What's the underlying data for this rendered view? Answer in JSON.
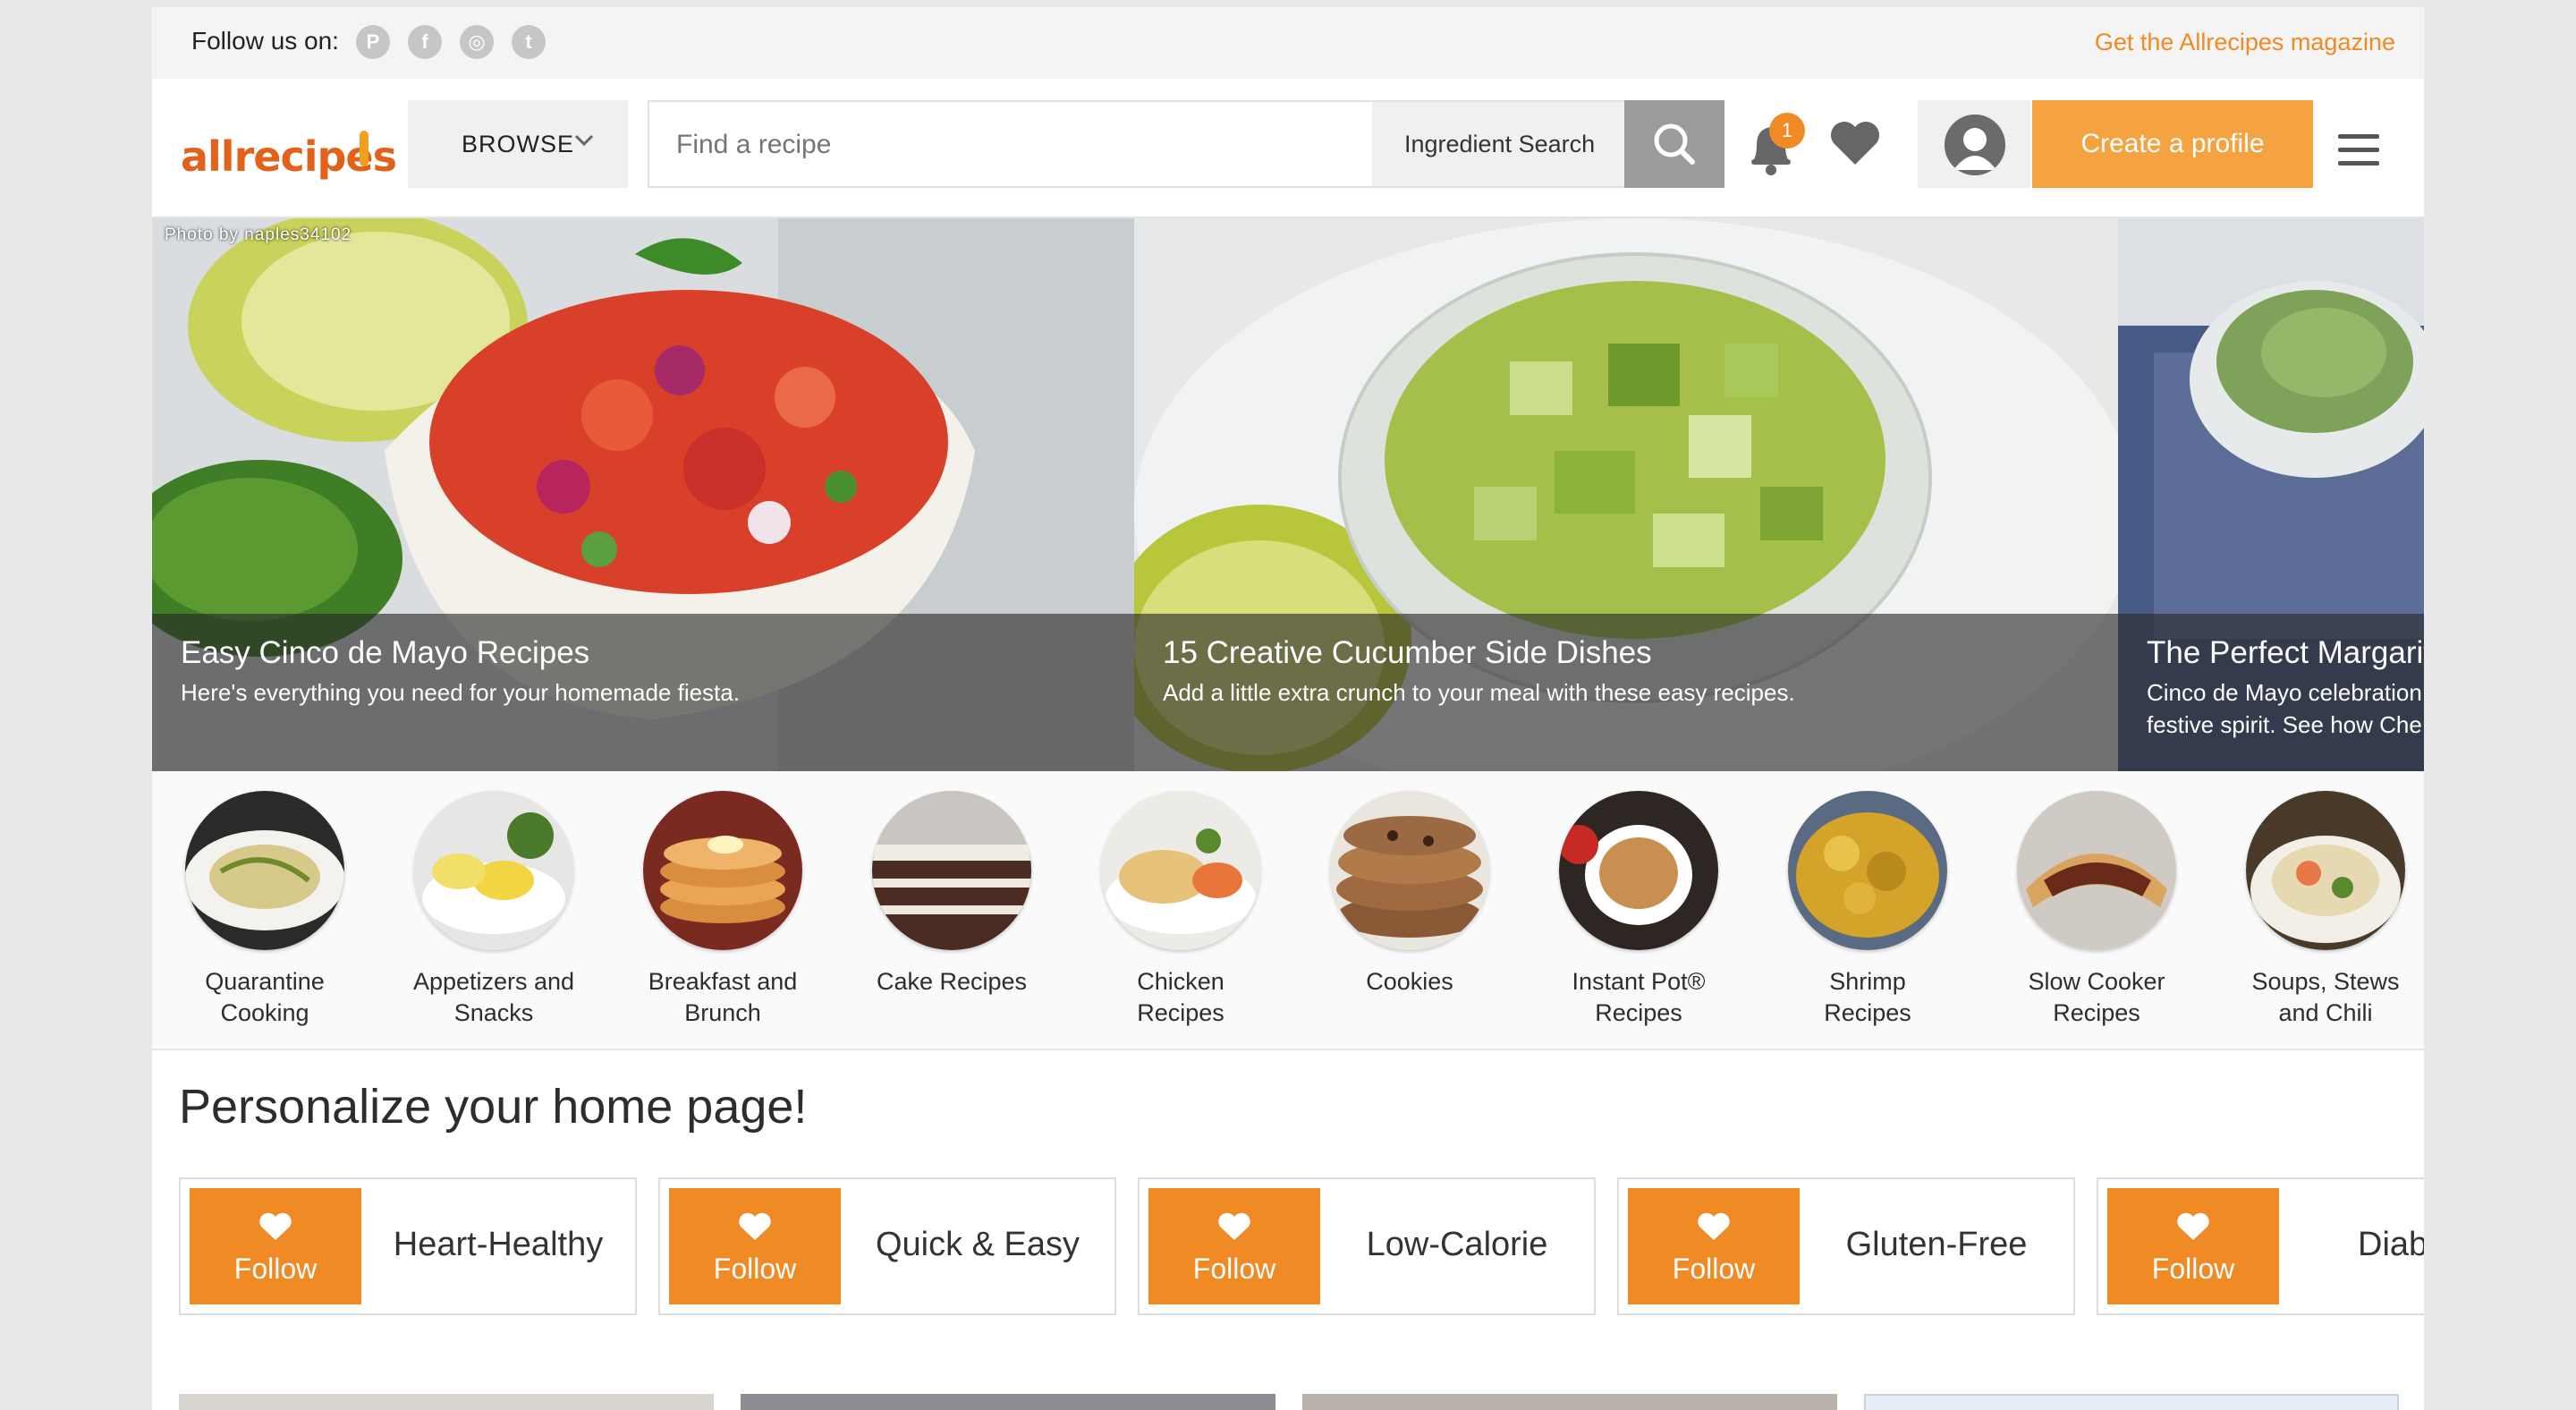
{
  "follow_bar": {
    "label": "Follow us on:",
    "social": [
      {
        "icon": "pinterest-icon",
        "glyph": "P"
      },
      {
        "icon": "facebook-icon",
        "glyph": "f"
      },
      {
        "icon": "instagram-icon",
        "glyph": "◎"
      },
      {
        "icon": "twitter-icon",
        "glyph": "t"
      }
    ],
    "magazine_link": "Get the Allrecipes magazine"
  },
  "header": {
    "logo": "allrecipes",
    "browse_label": "BROWSE",
    "search_placeholder": "Find a recipe",
    "ingredient_search": "Ingredient Search",
    "notification_count": "1",
    "create_profile": "Create a profile"
  },
  "carousel": {
    "photo_credit": "Photo by naples34102",
    "slides": [
      {
        "title": "Easy Cinco de Mayo Recipes",
        "subtitle": "Here's everything you need for your homemade fiesta."
      },
      {
        "title": "15 Creative Cucumber Side Dishes",
        "subtitle": "Add a little extra crunch to your meal with these easy recipes."
      },
      {
        "title": "The Perfect Margarita",
        "subtitle": "Cinco de Mayo celebration",
        "subtitle2": "festive spirit. See how Che"
      }
    ]
  },
  "categories": [
    {
      "line1": "Quarantine",
      "line2": "Cooking"
    },
    {
      "line1": "Appetizers and",
      "line2": "Snacks"
    },
    {
      "line1": "Breakfast and",
      "line2": "Brunch"
    },
    {
      "line1": "Cake Recipes",
      "line2": ""
    },
    {
      "line1": "Chicken",
      "line2": "Recipes"
    },
    {
      "line1": "Cookies",
      "line2": ""
    },
    {
      "line1": "Instant Pot®",
      "line2": "Recipes"
    },
    {
      "line1": "Shrimp",
      "line2": "Recipes"
    },
    {
      "line1": "Slow Cooker",
      "line2": "Recipes"
    },
    {
      "line1": "Soups, Stews",
      "line2": "and Chili"
    }
  ],
  "personalize": {
    "title": "Personalize your home page!",
    "follow_label": "Follow",
    "cards": [
      "Heart-Healthy",
      "Quick & Easy",
      "Low-Calorie",
      "Gluten-Free",
      "Diab"
    ]
  },
  "colors": {
    "accent": "#f08a24",
    "create_button": "#f5a340",
    "logo": "#e2621b"
  }
}
